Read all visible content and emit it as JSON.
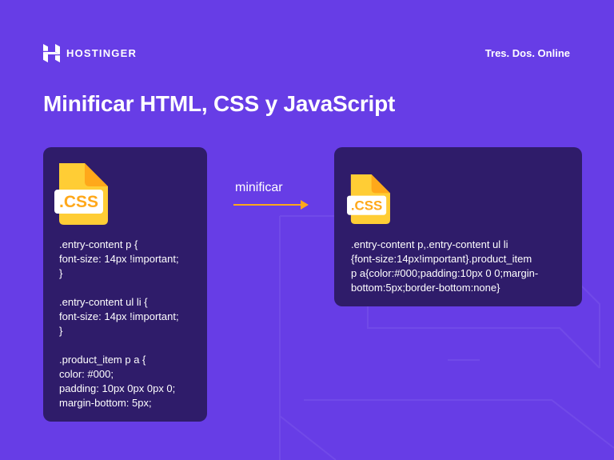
{
  "header": {
    "logo_text": "HOSTINGER",
    "right_text": "Tres. Dos. Online"
  },
  "title": "Minificar HTML, CSS y JavaScript",
  "left_card": {
    "badge": ".CSS",
    "code": ".entry-content p {\nfont-size: 14px !important;\n}\n\n.entry-content ul li {\nfont-size: 14px !important;\n}\n\n.product_item p a {\ncolor: #000;\npadding: 10px 0px 0px 0;\nmargin-bottom: 5px;"
  },
  "arrow": {
    "label": "minificar"
  },
  "right_card": {
    "badge": ".CSS",
    "code": ".entry-content p,.entry-content ul li\n{font-size:14px!important}.product_item\np a{color:#000;padding:10px 0 0;margin-\nbottom:5px;border-bottom:none}"
  },
  "colors": {
    "background": "#673de6",
    "card": "#2f1c6a",
    "file_yellow": "#ffcd35",
    "file_fold": "#ffa81a",
    "arrow": "#ffa81a"
  }
}
